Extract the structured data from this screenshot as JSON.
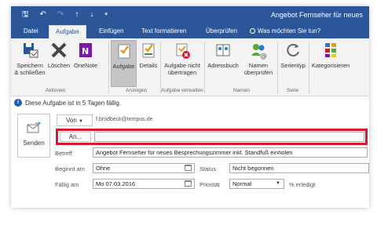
{
  "title_bar": {
    "window_title": "Angebot Fernseher für neues",
    "qat": {
      "save": "🖫",
      "undo": "↶",
      "redo": "↷",
      "up": "↑",
      "down": "↓",
      "more": "▾"
    }
  },
  "tabs": [
    {
      "label": "Datei"
    },
    {
      "label": "Aufgabe"
    },
    {
      "label": "Einfügen"
    },
    {
      "label": "Text formatieren"
    },
    {
      "label": "Überprüfen"
    },
    {
      "label": "Was möchten Sie tun?"
    }
  ],
  "ribbon": {
    "buttons": [
      {
        "label": "Speichern\n& schließen"
      },
      {
        "label": "Löschen"
      },
      {
        "label": "OneNote"
      },
      {
        "label": "Aufgabe"
      },
      {
        "label": "Details"
      },
      {
        "label": "Aufgabe nicht\nübertragen"
      },
      {
        "label": "Adressbuch"
      },
      {
        "label": "Namen\nüberprüfen"
      },
      {
        "label": "Serientyp"
      },
      {
        "label": "Kategorisieren"
      }
    ],
    "groups": [
      "Aktionen",
      "Anzeigen",
      "Aufgabe verwalten",
      "Namen",
      "Serie"
    ]
  },
  "info": {
    "text": "Diese Aufgabe ist in 5 Tagen fällig."
  },
  "form": {
    "send_label": "Senden",
    "from_label": "Von",
    "from_value": "f.brodbeck@tempus.de",
    "to_button": "An...",
    "to_value": "",
    "subject_label": "Betreff",
    "subject_value": "Angebot Fernseher für neues Besprechungszimmer inkl. Standfuß einholen",
    "start_label": "Beginnt am",
    "start_value": "Ohne",
    "due_label": "Fällig am",
    "due_value": "Mo 07.03.2016",
    "status_label": "Status",
    "status_value": "Nicht begonnen",
    "priority_label": "Priorität",
    "priority_value": "Normal",
    "done_label": "% erledigt"
  },
  "colors": {
    "accent": "#2b579a",
    "highlight": "#d6192e",
    "info": "#1e5fb4"
  }
}
